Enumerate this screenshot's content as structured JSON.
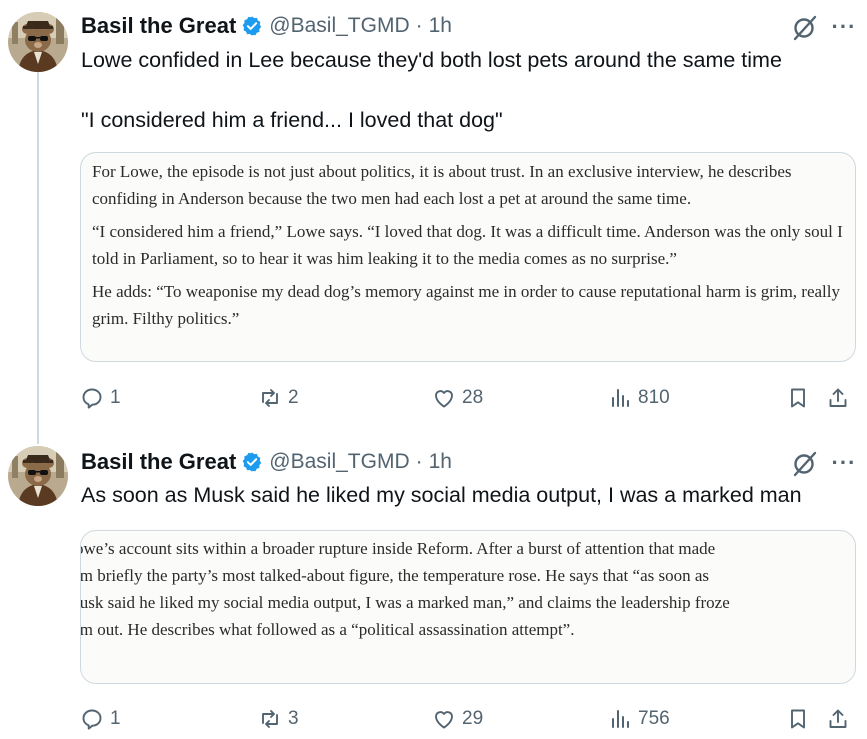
{
  "colors": {
    "verified": "#1d9bf0",
    "text": "#0f1419",
    "muted": "#536471",
    "border": "#cfd9de"
  },
  "icons": [
    "avatar",
    "verified-badge-icon",
    "grok-icon",
    "more-icon",
    "reply-icon",
    "repost-icon",
    "like-icon",
    "views-icon",
    "bookmark-icon",
    "share-icon"
  ],
  "tweets": [
    {
      "display_name": "Basil the Great",
      "handle": "@Basil_TGMD",
      "dot": "·",
      "time": "1h",
      "more": "···",
      "text_lines": [
        "Lowe confided in Lee because they'd both lost pets around the same time",
        "\"I considered him a friend... I loved that dog\""
      ],
      "article_paragraphs": [
        "For Lowe, the episode is not just about politics, it is about trust. In an exclusive interview, he describes confiding in Anderson because the two men had each lost a pet at around the same time.",
        "“I considered him a friend,” Lowe says. “I loved that dog. It was a difficult time. Anderson was the only soul I told in Parliament, so to hear it was him leaking it to the media comes as no surprise.”",
        "He adds: “To weaponise my dead dog’s memory against me in order to cause reputational harm is grim, really grim. Filthy politics.”"
      ],
      "stats": {
        "replies": "1",
        "reposts": "2",
        "likes": "28",
        "views": "810"
      }
    },
    {
      "display_name": "Basil the Great",
      "handle": "@Basil_TGMD",
      "dot": "·",
      "time": "1h",
      "more": "···",
      "text_lines": [
        "As soon as Musk said he liked my social media output, I was a marked man"
      ],
      "article_lines": [
        "owe’s account sits within a broader rupture inside Reform. After a burst of attention that made",
        "im briefly the party’s most talked-about figure, the temperature rose. He says that “as soon as",
        "lusk said he liked my social media output, I was a marked man,” and claims the leadership froze",
        "im out. He describes what followed as a “political assassination attempt”."
      ],
      "stats": {
        "replies": "1",
        "reposts": "3",
        "likes": "29",
        "views": "756"
      }
    }
  ]
}
